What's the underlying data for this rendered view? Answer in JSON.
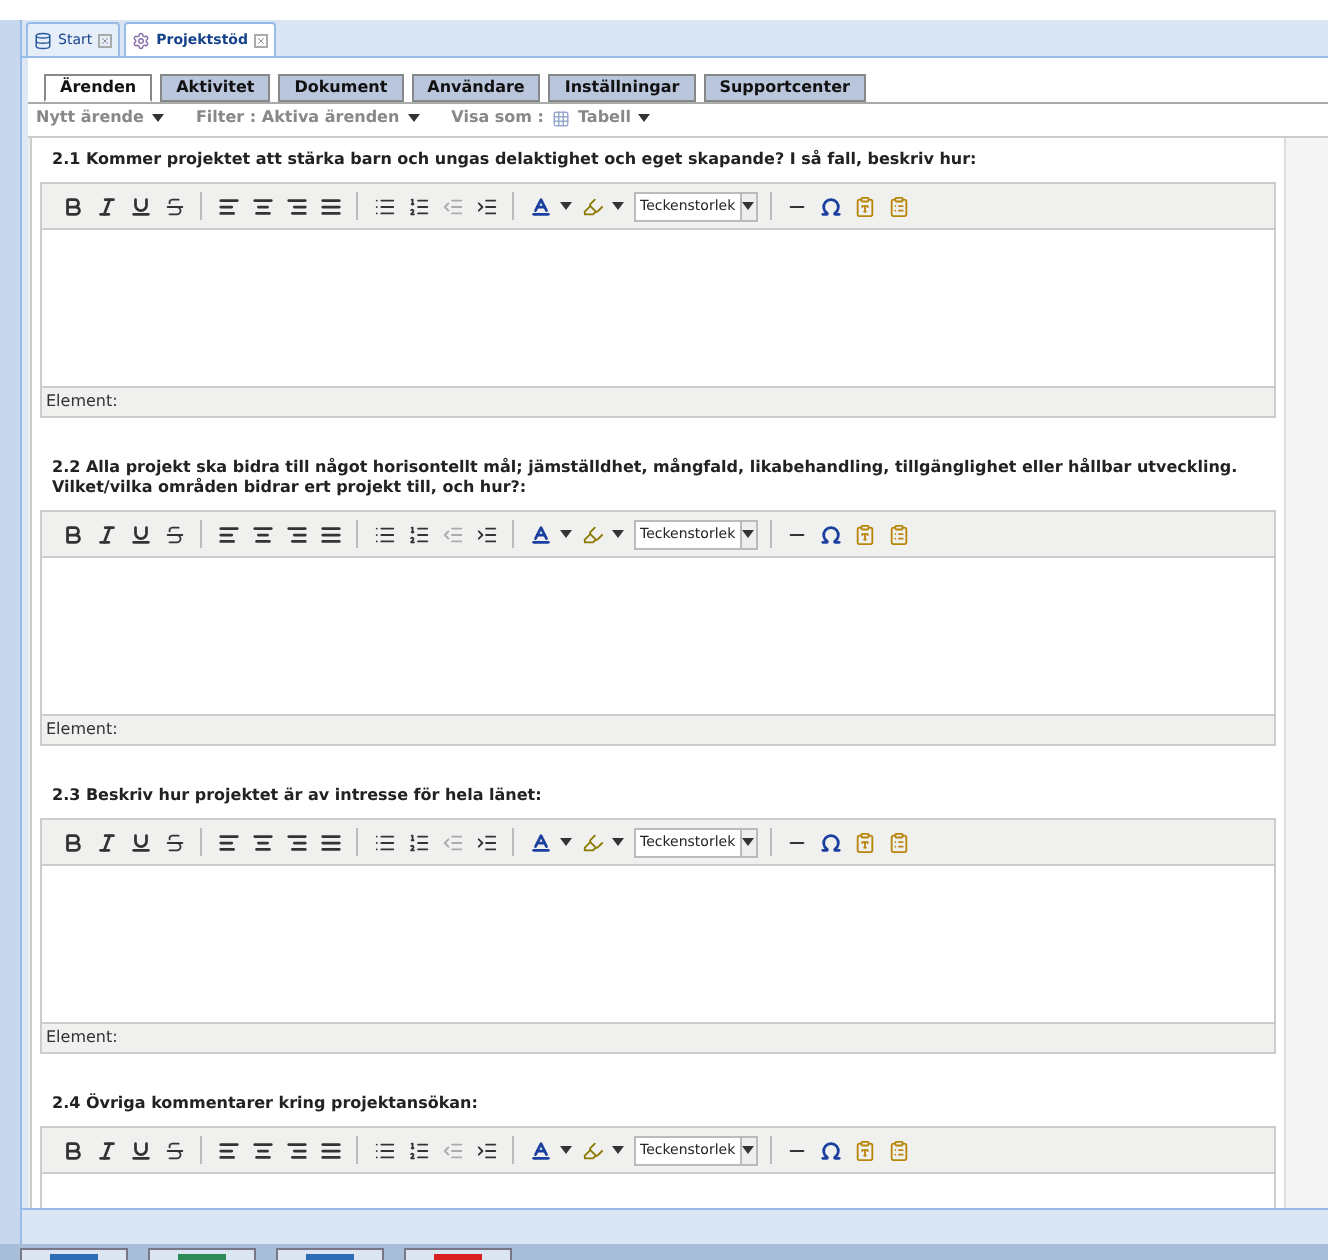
{
  "doc_tabs": [
    {
      "label": "Start",
      "selected": false,
      "kind": "start"
    },
    {
      "label": "Projektstöd",
      "selected": true,
      "kind": "module"
    }
  ],
  "section_tabs": [
    {
      "label": "Ärenden",
      "selected": true
    },
    {
      "label": "Aktivitet",
      "selected": false
    },
    {
      "label": "Dokument",
      "selected": false
    },
    {
      "label": "Användare",
      "selected": false
    },
    {
      "label": "Inställningar",
      "selected": false
    },
    {
      "label": "Supportcenter",
      "selected": false
    }
  ],
  "toolbar": [
    {
      "label": "Nytt ärende",
      "kind": "menu"
    },
    {
      "label": "Filter : Aktiva ärenden",
      "kind": "menu"
    },
    {
      "label": "Visa som :",
      "kind": "text"
    },
    {
      "label": "Tabell",
      "kind": "grid_menu"
    }
  ],
  "editors": [
    {
      "question": "2.1 Kommer projektet att stärka barn och ungas delaktighet och eget skapande? I så fall, beskriv hur:",
      "font_size": "Teckenstorlek",
      "status": "Element:"
    },
    {
      "question": "2.2 Alla projekt ska bidra till något horisontellt mål; jämställdhet, mångfald, likabehandling, tillgänglighet eller hållbar utveckling. Vilket/vilka områden bidrar ert projekt till, och hur?:",
      "font_size": "Teckenstorlek",
      "status": "Element:"
    },
    {
      "question": "2.3 Beskriv hur projektet är av intresse för hela länet:",
      "font_size": "Teckenstorlek",
      "status": "Element:"
    },
    {
      "question": "2.4 Övriga kommentarer kring projektansökan:",
      "font_size": "Teckenstorlek"
    }
  ],
  "taskbar": [
    {
      "color": "#2d6db5"
    },
    {
      "color": "#2e8b57"
    },
    {
      "color": "#2d6db5"
    },
    {
      "color": "#d81e1e"
    }
  ]
}
